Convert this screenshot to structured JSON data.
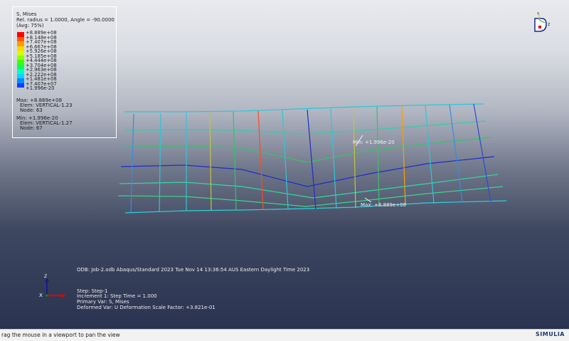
{
  "legend": {
    "var_title": "S, Mises",
    "rel_radius": "Rel. radius = 1.0000, Angle = -90.0000",
    "avg": "(Avg: 75%)",
    "ticks": [
      "+8.889e+08",
      "+8.148e+08",
      "+7.407e+08",
      "+6.667e+08",
      "+5.926e+08",
      "+5.185e+08",
      "+4.444e+08",
      "+3.704e+08",
      "+2.963e+08",
      "+2.222e+08",
      "+1.481e+08",
      "+7.407e+07",
      "+1.996e-20"
    ],
    "colors": [
      "#ff0000",
      "#ff5a00",
      "#ff9d00",
      "#ffd400",
      "#d4ff00",
      "#8cff00",
      "#3cff00",
      "#00ff64",
      "#00ffc8",
      "#00d8ff",
      "#008cff",
      "#0040ff",
      "#0000ff"
    ],
    "max_line": "Max: +8.889e+08",
    "max_elem": "Elem: VERTICAL-1.23",
    "max_node": "Node: 63",
    "min_line": "Min: +1.996e-20",
    "min_elem": "Elem: VERTICAL-1.27",
    "min_node": "Node: 67"
  },
  "annotations": {
    "min_label": "Min: +1.996e-20",
    "max_label": "Max: +8.889e+08"
  },
  "triad_small": {
    "y": "Y",
    "z": "Z",
    "x": "X"
  },
  "triad": {
    "z": "Z",
    "x": "X"
  },
  "info": {
    "odb": "ODB: Job-2.odb    Abaqus/Standard 2023    Tue Nov 14 13:36:54 AUS Eastern Daylight Time 2023",
    "step": "Step: Step-1",
    "increment": "Increment     1: Step Time =     1.000",
    "primary": "Primary Var: S, Mises",
    "deformed": "Deformed Var: U   Deformation Scale Factor: +3.821e-01"
  },
  "status": {
    "hint": "rag the mouse in a viewport to pan the view",
    "brand": "SIMULIA"
  }
}
